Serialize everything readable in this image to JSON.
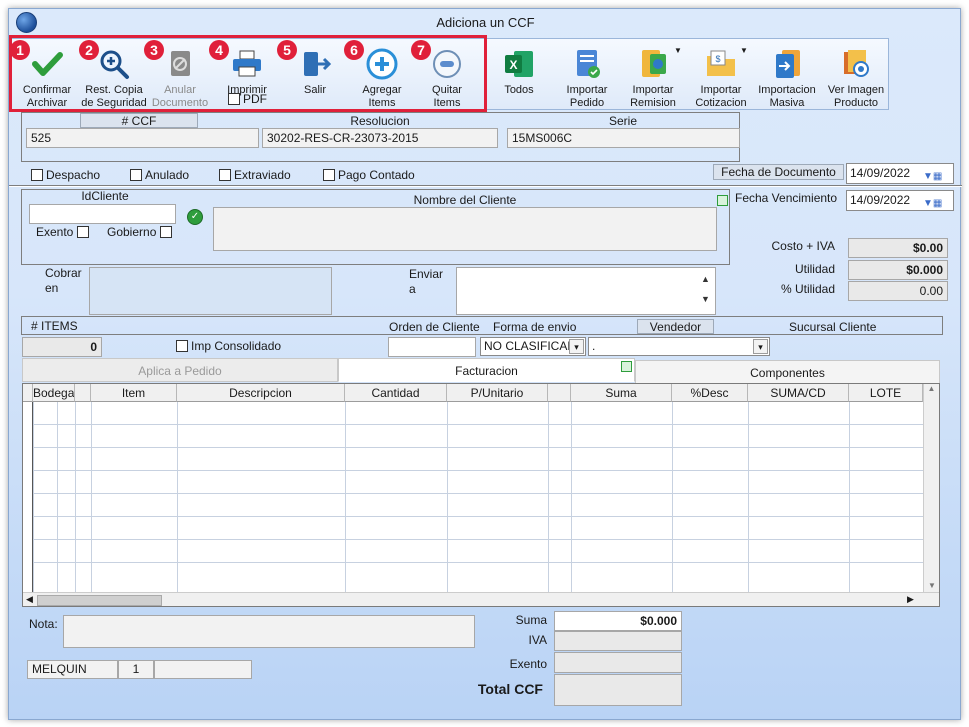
{
  "window": {
    "title": "Adiciona un CCF"
  },
  "toolbar": {
    "buttons": [
      {
        "num": "1",
        "label1": "Confirmar",
        "label2": "Archivar",
        "icon": "checkmark-icon"
      },
      {
        "num": "2",
        "label1": "Rest. Copia",
        "label2": "de Seguridad",
        "icon": "magnifier-plus-icon"
      },
      {
        "num": "3",
        "label1": "Anular",
        "label2": "Documento",
        "icon": "void-document-icon"
      },
      {
        "num": "4",
        "label1": "Imprimir",
        "label2": "PDF",
        "icon": "printer-icon"
      },
      {
        "num": "5",
        "label1": "Salir",
        "label2": "",
        "icon": "exit-door-icon"
      },
      {
        "num": "6",
        "label1": "Agregar",
        "label2": "Items",
        "icon": "plus-circle-icon"
      },
      {
        "num": "7",
        "label1": "Quitar",
        "label2": "Items",
        "icon": "minus-circle-icon"
      },
      {
        "num": "",
        "label1": "Todos",
        "label2": "",
        "icon": "excel-icon"
      },
      {
        "num": "",
        "label1": "Importar",
        "label2": "Pedido",
        "icon": "import-order-icon"
      },
      {
        "num": "",
        "label1": "Importar",
        "label2": "Remision",
        "icon": "import-remision-icon"
      },
      {
        "num": "",
        "label1": "Importar",
        "label2": "Cotizacion",
        "icon": "import-quote-icon"
      },
      {
        "num": "",
        "label1": "Importacion",
        "label2": "Masiva",
        "icon": "bulk-import-icon"
      },
      {
        "num": "",
        "label1": "Ver Imagen",
        "label2": "Producto",
        "icon": "product-image-icon"
      }
    ]
  },
  "doc": {
    "ccf_label": "# CCF",
    "ccf_value": "525",
    "resolucion_label": "Resolucion",
    "resolucion_value": "30202-RES-CR-23073-2015",
    "serie_label": "Serie",
    "serie_value": "15MS006C"
  },
  "flags": {
    "despacho": "Despacho",
    "anulado": "Anulado",
    "extraviado": "Extraviado",
    "pago_contado": "Pago Contado"
  },
  "dates": {
    "fecha_doc_label": "Fecha de  Documento",
    "fecha_doc_value": "14/09/2022",
    "fecha_venc_label": "Fecha Vencimiento",
    "fecha_venc_value": "14/09/2022"
  },
  "cliente": {
    "id_label": "IdCliente",
    "nombre_label": "Nombre del Cliente",
    "exento_label": "Exento",
    "gobierno_label": "Gobierno"
  },
  "costs": {
    "costo_iva_label": "Costo + IVA",
    "costo_iva_value": "$0.00",
    "utilidad_label": "Utilidad",
    "utilidad_value": "$0.000",
    "pct_utilidad_label": "% Utilidad",
    "pct_utilidad_value": "0.00"
  },
  "address": {
    "cobrar_label1": "Cobrar",
    "cobrar_label2": "en",
    "enviar_label1": "Enviar",
    "enviar_label2": "a"
  },
  "items_bar": {
    "items_label": "# ITEMS",
    "items_value": "0",
    "imp_consolidado": "Imp Consolidado",
    "orden_label": "Orden de Cliente",
    "forma_label": "Forma de envio",
    "forma_value": "NO CLASIFICAD",
    "vendedor_label": "Vendedor",
    "vendedor_value": ".",
    "sucursal_label": "Sucursal Cliente"
  },
  "tabs": {
    "aplica": "Aplica a Pedido",
    "facturacion": "Facturacion",
    "componentes": "Componentes"
  },
  "grid": {
    "columns": [
      "Bodega",
      "",
      "Item",
      "Descripcion",
      "Cantidad",
      "P/Unitario",
      "",
      "Suma",
      "%Desc",
      "SUMA/CD",
      "LOTE"
    ]
  },
  "footer": {
    "nota_label": "Nota:",
    "user": "MELQUIN",
    "user_num": "1",
    "suma_label": "Suma",
    "suma_value": "$0.000",
    "iva_label": "IVA",
    "exento_label": "Exento",
    "total_label": "Total CCF"
  },
  "colors": {
    "accent_red": "#e0203a",
    "green_check": "#2e9d3c"
  }
}
